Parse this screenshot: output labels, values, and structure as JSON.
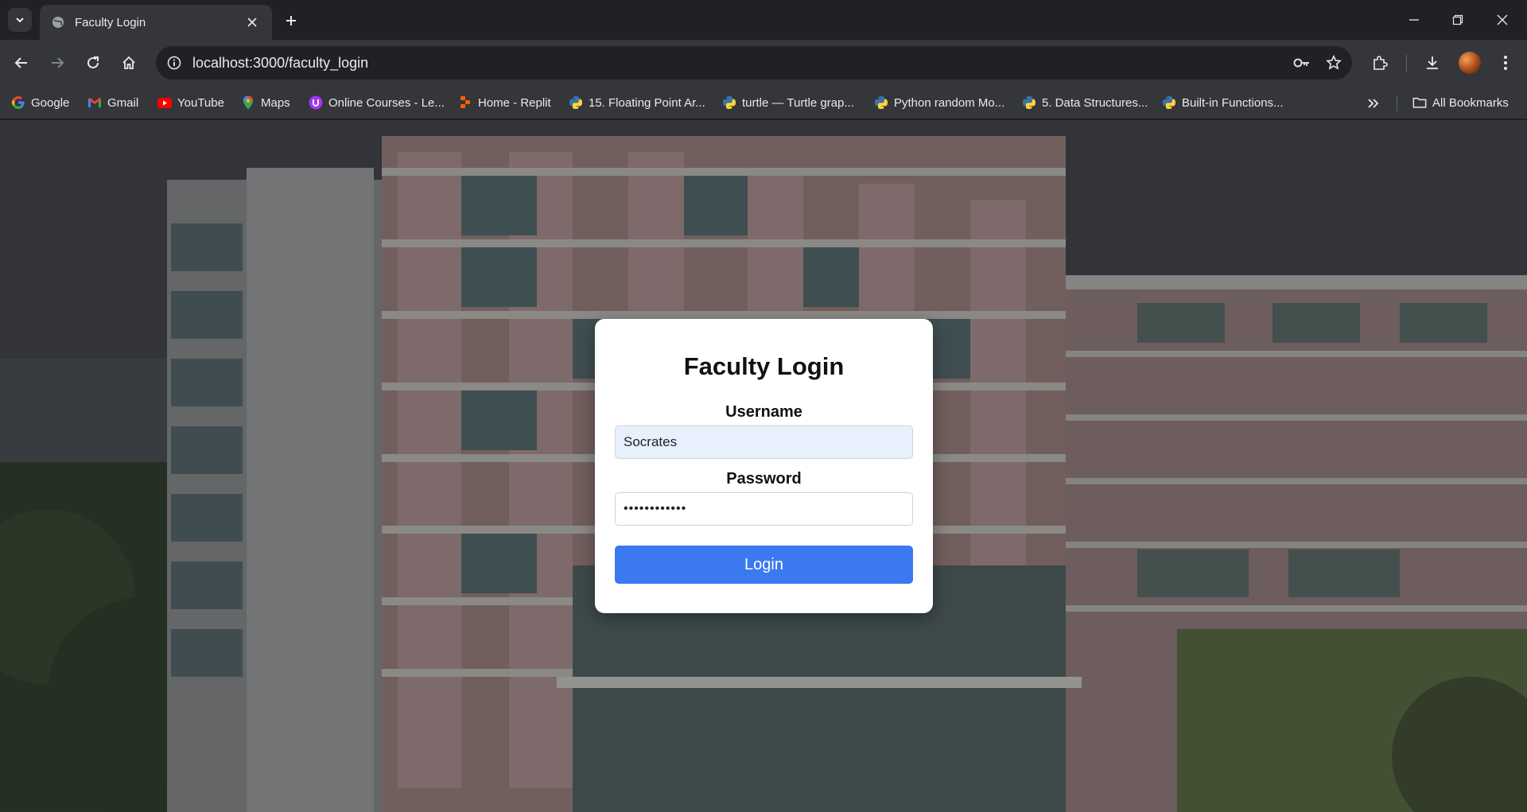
{
  "browser": {
    "tab": {
      "title": "Faculty Login",
      "favicon": "globe-icon"
    },
    "url": "localhost:3000/faculty_login",
    "bookmarks": [
      {
        "label": "Google",
        "icon": "google-icon"
      },
      {
        "label": "Gmail",
        "icon": "gmail-icon"
      },
      {
        "label": "YouTube",
        "icon": "youtube-icon"
      },
      {
        "label": "Maps",
        "icon": "maps-icon"
      },
      {
        "label": "Online Courses - Le...",
        "icon": "udemy-icon"
      },
      {
        "label": "Home - Replit",
        "icon": "replit-icon"
      },
      {
        "label": "15. Floating Point Ar...",
        "icon": "python-icon"
      },
      {
        "label": "turtle — Turtle grap...",
        "icon": "python-icon"
      },
      {
        "label": "Python random Mo...",
        "icon": "python-icon"
      },
      {
        "label": "5. Data Structures...",
        "icon": "python-icon"
      },
      {
        "label": "Built-in Functions...",
        "icon": "python-icon"
      }
    ],
    "all_bookmarks_label": "All Bookmarks"
  },
  "login": {
    "title": "Faculty Login",
    "username_label": "Username",
    "username_value": "Socrates",
    "password_label": "Password",
    "password_value": "••••••••••••",
    "button_label": "Login"
  },
  "colors": {
    "primary_button": "#3b79f0",
    "autofill_bg": "#e8f0fe",
    "chrome_dark": "#202124",
    "chrome_toolbar": "#35363a"
  }
}
